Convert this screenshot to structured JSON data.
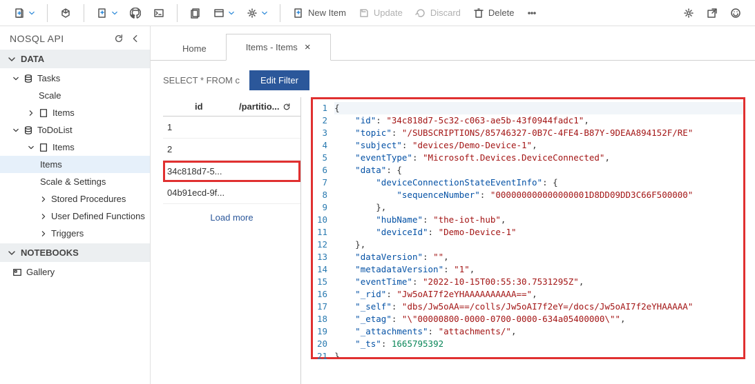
{
  "toolbar": {
    "new_item": "New Item",
    "update": "Update",
    "discard": "Discard",
    "delete": "Delete"
  },
  "sidebar": {
    "api_title": "NOSQL API",
    "section_data": "DATA",
    "section_notebooks": "NOTEBOOKS",
    "tasks": "Tasks",
    "scale": "Scale",
    "items": "Items",
    "todolist": "ToDoList",
    "items2": "Items",
    "items3": "Items",
    "scale_settings": "Scale & Settings",
    "stored_proc": "Stored Procedures",
    "udf": "User Defined Functions",
    "triggers": "Triggers",
    "gallery": "Gallery"
  },
  "tabs": {
    "home": "Home",
    "items": "Items - Items"
  },
  "query": {
    "text": "SELECT * FROM c",
    "edit_filter": "Edit Filter"
  },
  "item_list": {
    "col_id": "id",
    "col_part": "/partitio...",
    "rows": [
      "1",
      "2",
      "34c818d7-5...",
      "04b91ecd-9f..."
    ],
    "load_more": "Load more"
  },
  "json_doc": {
    "id": "34c818d7-5c32-c063-ae5b-43f0944fadc1",
    "topic": "/SUBSCRIPTIONS/85746327-0B7C-4FE4-B87Y-9DEAA894152F/RE",
    "subject": "devices/Demo-Device-1",
    "eventType": "Microsoft.Devices.DeviceConnected",
    "sequenceNumber": "000000000000000001D8DD09DD3C66F500000",
    "hubName": "the-iot-hub",
    "deviceId": "Demo-Device-1",
    "dataVersion": "",
    "metadataVersion": "1",
    "eventTime": "2022-10-15T00:55:30.7531295Z",
    "_rid": "Jw5oAI7f2eYHAAAAAAAAAA==",
    "_self": "dbs/Jw5oAA==/colls/Jw5oAI7f2eY=/docs/Jw5oAI7f2eYHAAAAA",
    "_etag": "\\\"00000800-0000-0700-0000-634a05400000\\\"",
    "_attachments": "attachments/",
    "_ts": 1665795392
  }
}
